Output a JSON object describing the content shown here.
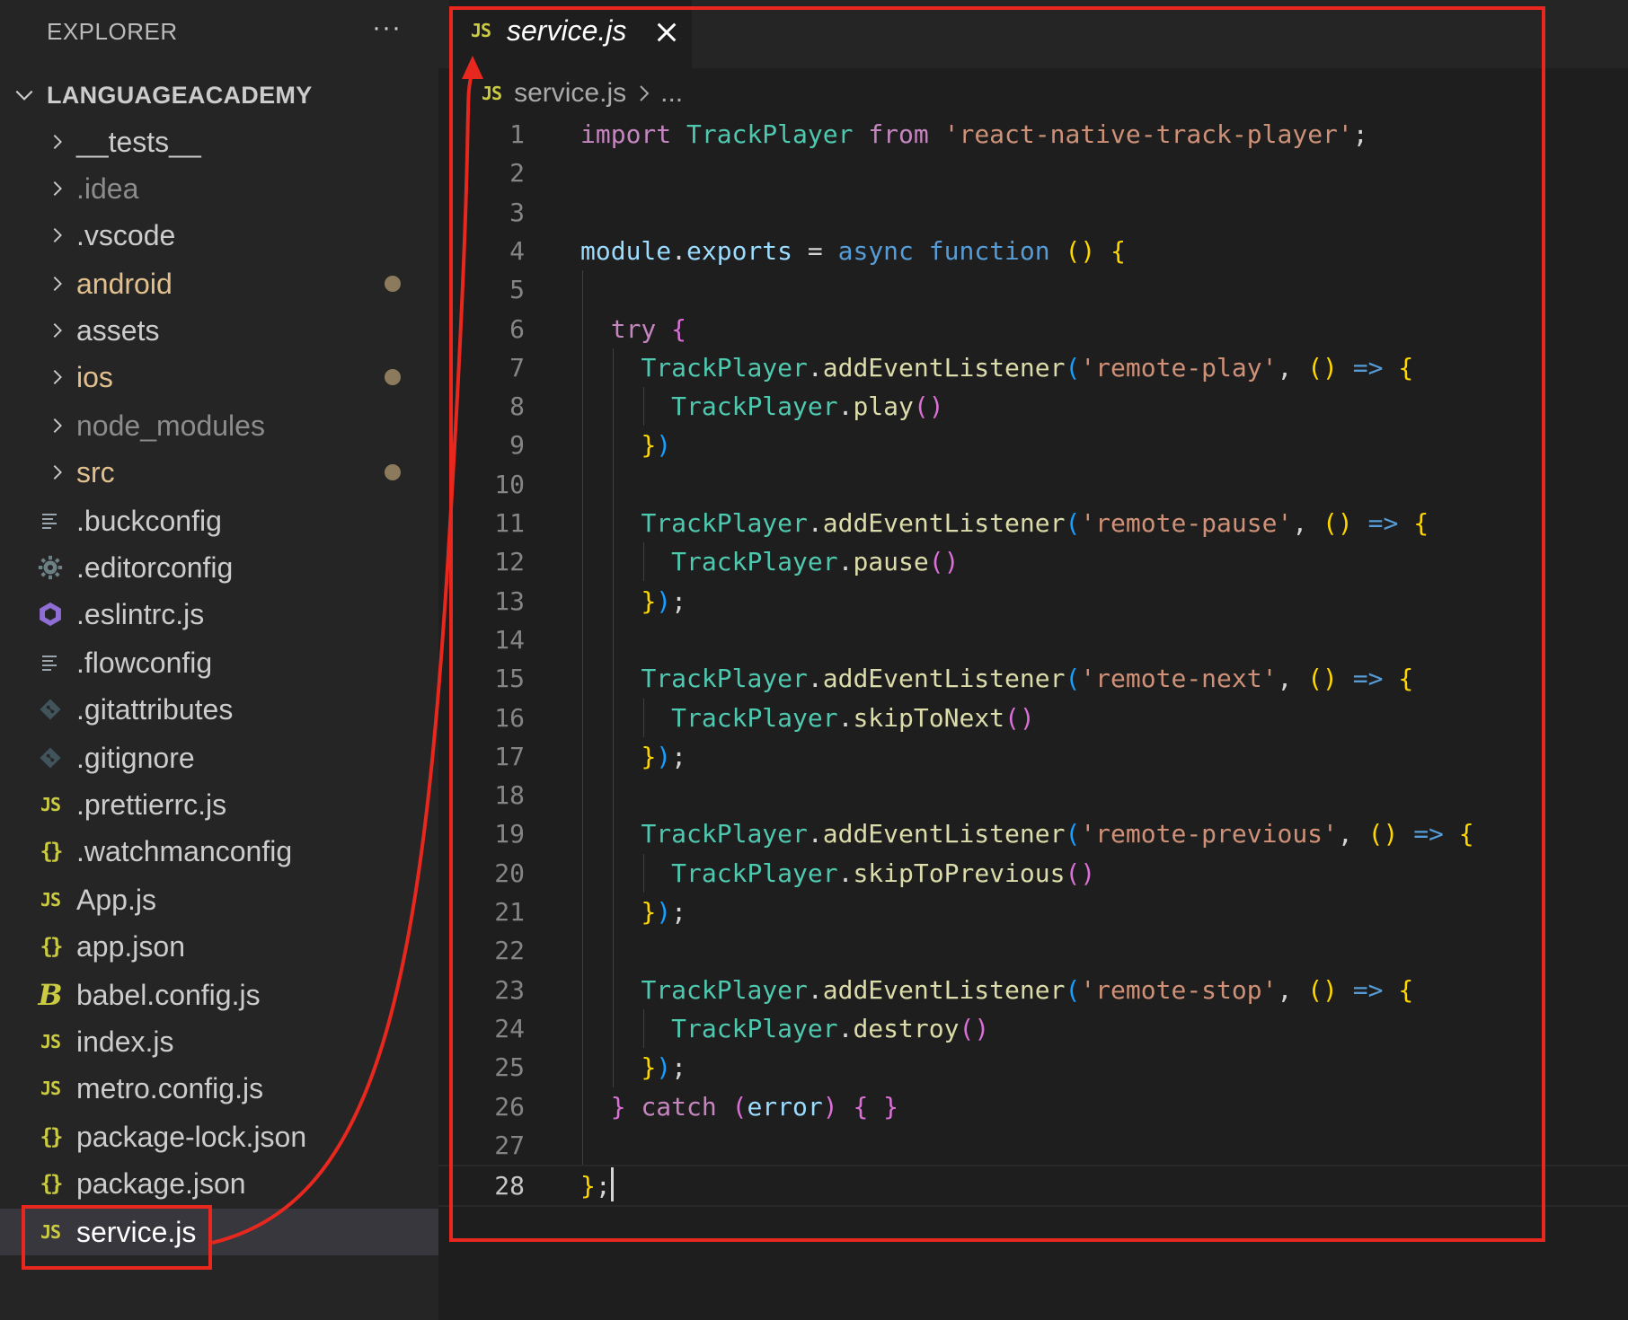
{
  "sidebar": {
    "header": "EXPLORER",
    "more_label": "···",
    "root_folder": "LANGUAGEACADEMY",
    "items": [
      {
        "label": "__tests__",
        "type": "folder",
        "color": "#cccccc",
        "modified": false
      },
      {
        "label": ".idea",
        "type": "folder",
        "color": "#8c8c8c",
        "modified": false
      },
      {
        "label": ".vscode",
        "type": "folder",
        "color": "#cccccc",
        "modified": false
      },
      {
        "label": "android",
        "type": "folder",
        "color": "#e2c08d",
        "modified": true
      },
      {
        "label": "assets",
        "type": "folder",
        "color": "#cccccc",
        "modified": false
      },
      {
        "label": "ios",
        "type": "folder",
        "color": "#e2c08d",
        "modified": true
      },
      {
        "label": "node_modules",
        "type": "folder",
        "color": "#8c8c8c",
        "modified": false
      },
      {
        "label": "src",
        "type": "folder",
        "color": "#e2c08d",
        "modified": true
      },
      {
        "label": ".buckconfig",
        "type": "file",
        "icon": "lines-icon",
        "color": "#cccccc"
      },
      {
        "label": ".editorconfig",
        "type": "file",
        "icon": "gear-icon",
        "color": "#cccccc"
      },
      {
        "label": ".eslintrc.js",
        "type": "file",
        "icon": "eslint-icon",
        "color": "#cccccc"
      },
      {
        "label": ".flowconfig",
        "type": "file",
        "icon": "lines-icon",
        "color": "#cccccc"
      },
      {
        "label": ".gitattributes",
        "type": "file",
        "icon": "git-icon",
        "color": "#cccccc"
      },
      {
        "label": ".gitignore",
        "type": "file",
        "icon": "git-icon",
        "color": "#cccccc"
      },
      {
        "label": ".prettierrc.js",
        "type": "file",
        "icon": "js-icon",
        "color": "#cccccc"
      },
      {
        "label": ".watchmanconfig",
        "type": "file",
        "icon": "json-icon",
        "color": "#cccccc"
      },
      {
        "label": "App.js",
        "type": "file",
        "icon": "js-icon",
        "color": "#cccccc"
      },
      {
        "label": "app.json",
        "type": "file",
        "icon": "json-icon",
        "color": "#cccccc"
      },
      {
        "label": "babel.config.js",
        "type": "file",
        "icon": "babel-icon",
        "color": "#cccccc"
      },
      {
        "label": "index.js",
        "type": "file",
        "icon": "js-icon",
        "color": "#cccccc"
      },
      {
        "label": "metro.config.js",
        "type": "file",
        "icon": "js-icon",
        "color": "#cccccc"
      },
      {
        "label": "package-lock.json",
        "type": "file",
        "icon": "json-icon",
        "color": "#cccccc"
      },
      {
        "label": "package.json",
        "type": "file",
        "icon": "json-icon",
        "color": "#cccccc"
      },
      {
        "label": "service.js",
        "type": "file",
        "icon": "js-icon",
        "color": "#ffffff",
        "selected": true
      }
    ]
  },
  "badges": {
    "js": "JS",
    "json": "{}",
    "babel": "B"
  },
  "tab": {
    "label": "service.js",
    "icon": "js-icon",
    "close_icon": "close-icon"
  },
  "breadcrumb": {
    "file": "service.js",
    "more": "..."
  },
  "editor": {
    "current_line": 28,
    "lines": [
      [
        [
          "import",
          "kw"
        ],
        [
          " ",
          "punc"
        ],
        [
          "TrackPlayer",
          "cls"
        ],
        [
          " ",
          "punc"
        ],
        [
          "from",
          "kw"
        ],
        [
          " ",
          "punc"
        ],
        [
          "'react-native-track-player'",
          "str"
        ],
        [
          ";",
          "punc"
        ]
      ],
      [],
      [],
      [
        [
          "module",
          "var"
        ],
        [
          ".",
          "punc"
        ],
        [
          "exports",
          "var"
        ],
        [
          " = ",
          "punc"
        ],
        [
          "async",
          "kwb"
        ],
        [
          " ",
          "punc"
        ],
        [
          "function",
          "kwb"
        ],
        [
          " ",
          "punc"
        ],
        [
          "()",
          "p1"
        ],
        [
          " ",
          "punc"
        ],
        [
          "{",
          "p1"
        ]
      ],
      [],
      [
        [
          "  ",
          "punc"
        ],
        [
          "try",
          "kw"
        ],
        [
          " ",
          "punc"
        ],
        [
          "{",
          "p2"
        ]
      ],
      [
        [
          "    ",
          "punc"
        ],
        [
          "TrackPlayer",
          "cls"
        ],
        [
          ".",
          "punc"
        ],
        [
          "addEventListener",
          "fn"
        ],
        [
          "(",
          "p3"
        ],
        [
          "'remote-play'",
          "str"
        ],
        [
          ", ",
          "punc"
        ],
        [
          "()",
          "p1"
        ],
        [
          " ",
          "punc"
        ],
        [
          "=>",
          "kwb"
        ],
        [
          " ",
          "punc"
        ],
        [
          "{",
          "p1"
        ]
      ],
      [
        [
          "      ",
          "punc"
        ],
        [
          "TrackPlayer",
          "cls"
        ],
        [
          ".",
          "punc"
        ],
        [
          "play",
          "fn"
        ],
        [
          "()",
          "p2"
        ]
      ],
      [
        [
          "    ",
          "punc"
        ],
        [
          "}",
          "p1"
        ],
        [
          ")",
          "p3"
        ]
      ],
      [],
      [
        [
          "    ",
          "punc"
        ],
        [
          "TrackPlayer",
          "cls"
        ],
        [
          ".",
          "punc"
        ],
        [
          "addEventListener",
          "fn"
        ],
        [
          "(",
          "p3"
        ],
        [
          "'remote-pause'",
          "str"
        ],
        [
          ", ",
          "punc"
        ],
        [
          "()",
          "p1"
        ],
        [
          " ",
          "punc"
        ],
        [
          "=>",
          "kwb"
        ],
        [
          " ",
          "punc"
        ],
        [
          "{",
          "p1"
        ]
      ],
      [
        [
          "      ",
          "punc"
        ],
        [
          "TrackPlayer",
          "cls"
        ],
        [
          ".",
          "punc"
        ],
        [
          "pause",
          "fn"
        ],
        [
          "()",
          "p2"
        ]
      ],
      [
        [
          "    ",
          "punc"
        ],
        [
          "}",
          "p1"
        ],
        [
          ")",
          "p3"
        ],
        [
          ";",
          "punc"
        ]
      ],
      [],
      [
        [
          "    ",
          "punc"
        ],
        [
          "TrackPlayer",
          "cls"
        ],
        [
          ".",
          "punc"
        ],
        [
          "addEventListener",
          "fn"
        ],
        [
          "(",
          "p3"
        ],
        [
          "'remote-next'",
          "str"
        ],
        [
          ", ",
          "punc"
        ],
        [
          "()",
          "p1"
        ],
        [
          " ",
          "punc"
        ],
        [
          "=>",
          "kwb"
        ],
        [
          " ",
          "punc"
        ],
        [
          "{",
          "p1"
        ]
      ],
      [
        [
          "      ",
          "punc"
        ],
        [
          "TrackPlayer",
          "cls"
        ],
        [
          ".",
          "punc"
        ],
        [
          "skipToNext",
          "fn"
        ],
        [
          "()",
          "p2"
        ]
      ],
      [
        [
          "    ",
          "punc"
        ],
        [
          "}",
          "p1"
        ],
        [
          ")",
          "p3"
        ],
        [
          ";",
          "punc"
        ]
      ],
      [],
      [
        [
          "    ",
          "punc"
        ],
        [
          "TrackPlayer",
          "cls"
        ],
        [
          ".",
          "punc"
        ],
        [
          "addEventListener",
          "fn"
        ],
        [
          "(",
          "p3"
        ],
        [
          "'remote-previous'",
          "str"
        ],
        [
          ", ",
          "punc"
        ],
        [
          "()",
          "p1"
        ],
        [
          " ",
          "punc"
        ],
        [
          "=>",
          "kwb"
        ],
        [
          " ",
          "punc"
        ],
        [
          "{",
          "p1"
        ]
      ],
      [
        [
          "      ",
          "punc"
        ],
        [
          "TrackPlayer",
          "cls"
        ],
        [
          ".",
          "punc"
        ],
        [
          "skipToPrevious",
          "fn"
        ],
        [
          "()",
          "p2"
        ]
      ],
      [
        [
          "    ",
          "punc"
        ],
        [
          "}",
          "p1"
        ],
        [
          ")",
          "p3"
        ],
        [
          ";",
          "punc"
        ]
      ],
      [],
      [
        [
          "    ",
          "punc"
        ],
        [
          "TrackPlayer",
          "cls"
        ],
        [
          ".",
          "punc"
        ],
        [
          "addEventListener",
          "fn"
        ],
        [
          "(",
          "p3"
        ],
        [
          "'remote-stop'",
          "str"
        ],
        [
          ", ",
          "punc"
        ],
        [
          "()",
          "p1"
        ],
        [
          " ",
          "punc"
        ],
        [
          "=>",
          "kwb"
        ],
        [
          " ",
          "punc"
        ],
        [
          "{",
          "p1"
        ]
      ],
      [
        [
          "      ",
          "punc"
        ],
        [
          "TrackPlayer",
          "cls"
        ],
        [
          ".",
          "punc"
        ],
        [
          "destroy",
          "fn"
        ],
        [
          "()",
          "p2"
        ]
      ],
      [
        [
          "    ",
          "punc"
        ],
        [
          "}",
          "p1"
        ],
        [
          ")",
          "p3"
        ],
        [
          ";",
          "punc"
        ]
      ],
      [
        [
          "  ",
          "punc"
        ],
        [
          "}",
          "p2"
        ],
        [
          " ",
          "punc"
        ],
        [
          "catch",
          "kw"
        ],
        [
          " ",
          "punc"
        ],
        [
          "(",
          "p2"
        ],
        [
          "error",
          "var"
        ],
        [
          ")",
          "p2"
        ],
        [
          " ",
          "punc"
        ],
        [
          "{ }",
          "p2"
        ]
      ],
      [],
      [
        [
          "}",
          "p1"
        ],
        [
          ";",
          "punc"
        ]
      ]
    ]
  },
  "colors": {
    "annotation": "#e8281f",
    "sidebar_bg": "#252526",
    "editor_bg": "#1e1e1e",
    "modified_dot": "#8c7a5c"
  }
}
